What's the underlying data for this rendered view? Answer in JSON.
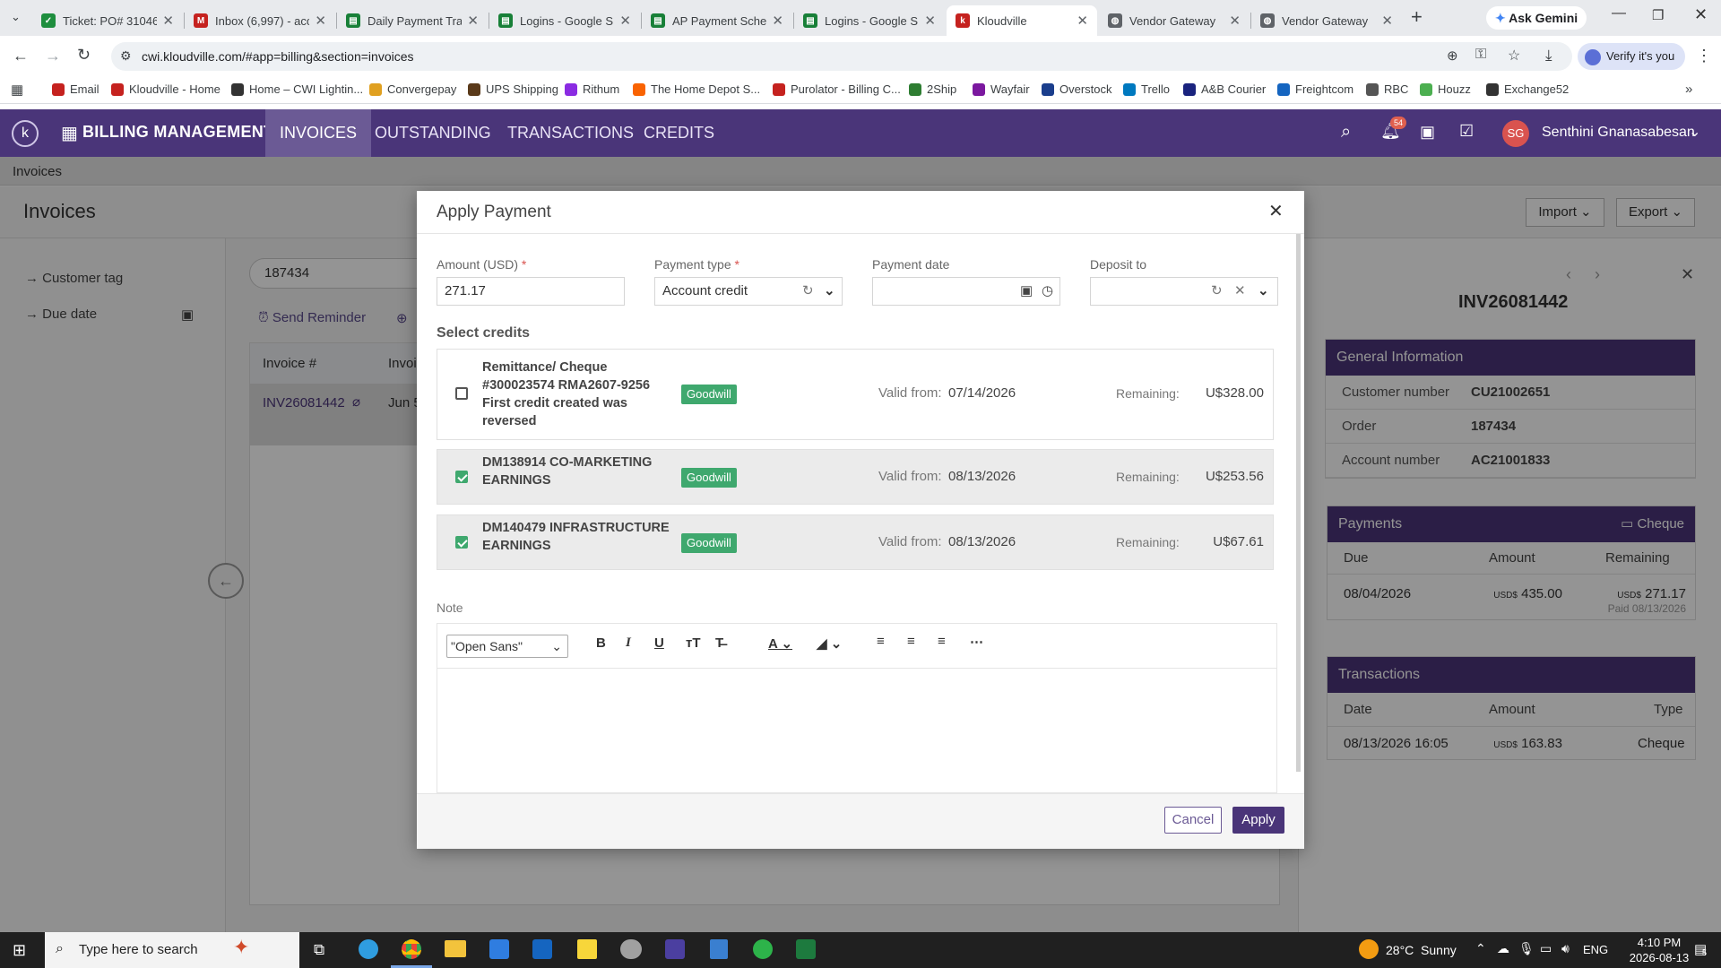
{
  "browser": {
    "tabs": [
      {
        "title": "Ticket: PO# 31046",
        "color": "#1e8e3e",
        "glyph": "✓"
      },
      {
        "title": "Inbox (6,997) - acc",
        "color": "#c5221f",
        "glyph": "M"
      },
      {
        "title": "Daily Payment Tra",
        "color": "#188038",
        "glyph": "▤"
      },
      {
        "title": "Logins - Google Sh",
        "color": "#188038",
        "glyph": "▤"
      },
      {
        "title": "AP Payment Sched",
        "color": "#188038",
        "glyph": "▤"
      },
      {
        "title": "Logins - Google Sh",
        "color": "#188038",
        "glyph": "▤"
      },
      {
        "title": "Kloudville",
        "color": "#c5221f",
        "glyph": "k",
        "active": true
      },
      {
        "title": "Vendor Gateway",
        "color": "#5f6368",
        "glyph": "◍"
      },
      {
        "title": "Vendor Gateway",
        "color": "#5f6368",
        "glyph": "◍"
      }
    ],
    "ask_gemini": "Ask Gemini",
    "url": "cwi.kloudville.com/#app=billing&section=invoices",
    "verify": "Verify it's you",
    "bookmarks": [
      {
        "label": "Email",
        "color": "#c5221f"
      },
      {
        "label": "Kloudville - Home",
        "color": "#c5221f"
      },
      {
        "label": "Home – CWI Lightin...",
        "color": "#333"
      },
      {
        "label": "Convergepay",
        "color": "#e0a020"
      },
      {
        "label": "UPS Shipping",
        "color": "#5a3a1a"
      },
      {
        "label": "Rithum",
        "color": "#8a2be2"
      },
      {
        "label": "The Home Depot S...",
        "color": "#f96302"
      },
      {
        "label": "Purolator - Billing C...",
        "color": "#c5221f"
      },
      {
        "label": "2Ship",
        "color": "#2e7d32"
      },
      {
        "label": "Wayfair",
        "color": "#7b189f"
      },
      {
        "label": "Overstock",
        "color": "#1a3e8c"
      },
      {
        "label": "Trello",
        "color": "#0079bf"
      },
      {
        "label": "A&B Courier",
        "color": "#1a237e"
      },
      {
        "label": "Freightcom",
        "color": "#1565c0"
      },
      {
        "label": "RBC",
        "color": "#555"
      },
      {
        "label": "Houzz",
        "color": "#4caf50"
      },
      {
        "label": "Exchange52",
        "color": "#333"
      }
    ]
  },
  "app": {
    "module": "BILLING MANAGEMENT",
    "nav": [
      "INVOICES",
      "OUTSTANDING",
      "TRANSACTIONS",
      "CREDITS"
    ],
    "notif_count": "54",
    "user_initials": "SG",
    "user_name": "Senthini Gnanasabesan",
    "breadcrumb": "Invoices",
    "page_title": "Invoices",
    "import": "Import",
    "export": "Export",
    "filters": [
      "Customer tag",
      "Due date"
    ],
    "search_value": "187434",
    "send_reminder": "Send Reminder",
    "table_headers": [
      "Invoice #",
      "Invoi"
    ],
    "row": {
      "invoice": "INV26081442",
      "date": "Jun 5"
    }
  },
  "details": {
    "invoice": "INV26081442",
    "general_title": "General Information",
    "general": [
      {
        "k": "Customer number",
        "v": "CU21002651"
      },
      {
        "k": "Order",
        "v": "187434"
      },
      {
        "k": "Account number",
        "v": "AC21001833"
      }
    ],
    "payments_title": "Payments",
    "payments_method": "Cheque",
    "payments_headers": [
      "Due",
      "Amount",
      "Remaining"
    ],
    "payment": {
      "due": "08/04/2026",
      "cur": "USD$",
      "amount": "435.00",
      "remaining": "271.17",
      "paid": "Paid 08/13/2026"
    },
    "transactions_title": "Transactions",
    "transactions_headers": [
      "Date",
      "Amount",
      "Type"
    ],
    "transaction": {
      "date": "08/13/2026 16:05",
      "cur": "USD$",
      "amount": "163.83",
      "type": "Cheque"
    }
  },
  "modal": {
    "title": "Apply Payment",
    "amount_label": "Amount (USD)",
    "amount_value": "271.17",
    "ptype_label": "Payment type",
    "ptype_value": "Account credit",
    "pdate_label": "Payment date",
    "deposit_label": "Deposit to",
    "select_credits": "Select credits",
    "valid_from": "Valid from:",
    "remaining": "Remaining:",
    "credits": [
      {
        "title": "Remittance/ Cheque #300023574 RMA2607-9256 First credit created was reversed",
        "lines": [
          "Remittance/ Cheque",
          "#300023574 RMA2607-9256",
          "First credit created was",
          "reversed"
        ],
        "badge": "Goodwill",
        "valid": "07/14/2026",
        "amount": "U$328.00",
        "checked": false
      },
      {
        "title": "DM138914 CO-MARKETING EARNINGS",
        "lines": [
          "DM138914 CO-MARKETING",
          "EARNINGS"
        ],
        "badge": "Goodwill",
        "valid": "08/13/2026",
        "amount": "U$253.56",
        "checked": true
      },
      {
        "title": "DM140479 INFRASTRUCTURE EARNINGS",
        "lines": [
          "DM140479 INFRASTRUCTURE",
          "EARNINGS"
        ],
        "badge": "Goodwill",
        "valid": "08/13/2026",
        "amount": "U$67.61",
        "checked": true
      }
    ],
    "note_label": "Note",
    "font_select": "\"Open Sans\"",
    "cancel": "Cancel",
    "apply": "Apply"
  },
  "taskbar": {
    "search_placeholder": "Type here to search",
    "weather": "28°C  Sunny",
    "lang": "ENG",
    "time": "4:10 PM",
    "date": "2026-08-13",
    "notif": "5"
  },
  "colors": {
    "brand": "#4a3579",
    "goodwill": "#3fa86e",
    "required": "#d9534f"
  }
}
